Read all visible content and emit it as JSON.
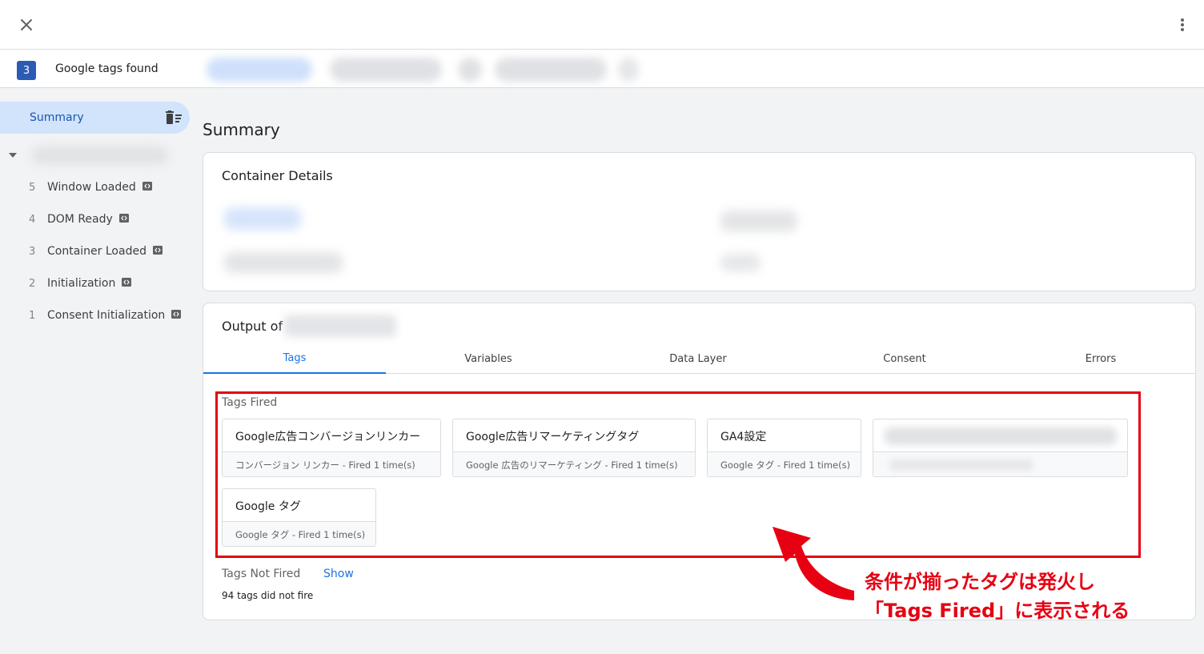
{
  "topbar": {
    "close_icon": "close-icon",
    "more_icon": "more-vert-icon"
  },
  "tagbar": {
    "count": "3",
    "label": "Google tags found"
  },
  "sidebar": {
    "summary_label": "Summary",
    "delete_icon": "delete-sweep-icon",
    "events": [
      {
        "num": "5",
        "name": "Window Loaded"
      },
      {
        "num": "4",
        "name": "DOM Ready"
      },
      {
        "num": "3",
        "name": "Container Loaded"
      },
      {
        "num": "2",
        "name": "Initialization"
      },
      {
        "num": "1",
        "name": "Consent Initialization"
      }
    ]
  },
  "main": {
    "title": "Summary",
    "container_details_title": "Container Details",
    "output_title": "Output of",
    "tabs": [
      "Tags",
      "Variables",
      "Data Layer",
      "Consent",
      "Errors"
    ],
    "tags_fired_label": "Tags Fired",
    "fired_tags": [
      {
        "name": "Google広告コンバージョンリンカー",
        "sub": "コンバージョン リンカー - Fired 1 time(s)"
      },
      {
        "name": "Google広告リマーケティングタグ",
        "sub": "Google 広告のリマーケティング - Fired 1 time(s)"
      },
      {
        "name": "GA4設定",
        "sub": "Google タグ - Fired 1 time(s)"
      },
      {
        "name": "Google タグ",
        "sub": "Google タグ - Fired 1 time(s)"
      }
    ],
    "tags_not_fired_label": "Tags Not Fired",
    "show_link": "Show",
    "not_fired_count": "94 tags did not fire"
  },
  "annotation": {
    "line1": "条件が揃ったタグは発火し",
    "line2": "「Tags Fired」に表示される",
    "color": "#e60012"
  },
  "colors": {
    "accent": "#1a73e8",
    "selected_bg": "#d2e3fc",
    "badge": "#2b5bb5"
  }
}
